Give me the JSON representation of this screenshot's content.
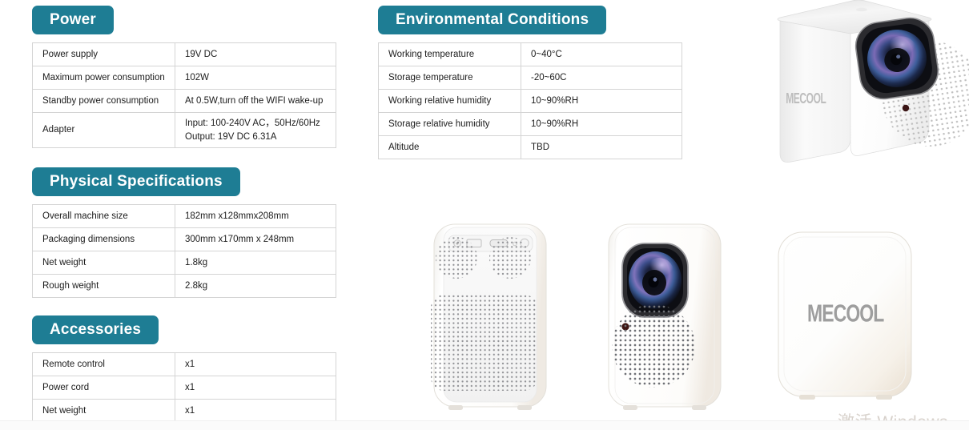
{
  "sections": [
    {
      "id": "power",
      "title": "Power",
      "rows": [
        {
          "key": "Power supply",
          "value": "19V DC"
        },
        {
          "key": "Maximum power consumption",
          "value": "102W"
        },
        {
          "key": "Standby power consumption",
          "value": "At 0.5W,turn off the WIFI wake-up"
        },
        {
          "key": "Adapter",
          "value_line1": "Input: 100-240V AC，50Hz/60Hz",
          "value_line2": "Output: 19V DC 6.31A"
        }
      ]
    },
    {
      "id": "physical",
      "title": "Physical Specifications",
      "rows": [
        {
          "key": "Overall machine size",
          "value": "182mm x128mmx208mm"
        },
        {
          "key": "Packaging dimensions",
          "value": "300mm x170mm x 248mm"
        },
        {
          "key": "Net weight",
          "value": "1.8kg"
        },
        {
          "key": "Rough weight",
          "value": "2.8kg"
        }
      ]
    },
    {
      "id": "accessories",
      "title": "Accessories",
      "rows": [
        {
          "key": "Remote control",
          "value": "x1"
        },
        {
          "key": "Power cord",
          "value": "x1"
        },
        {
          "key": "Net weight",
          "value": "x1"
        }
      ]
    },
    {
      "id": "environmental",
      "title": "Environmental Conditions",
      "rows": [
        {
          "key": "Working temperature",
          "value": "0~40°C"
        },
        {
          "key": "Storage temperature",
          "value": "-20~60C"
        },
        {
          "key": "Working relative humidity",
          "value": "10~90%RH"
        },
        {
          "key": "Storage relative humidity",
          "value": "10~90%RH"
        },
        {
          "key": "Altitude",
          "value": "TBD"
        }
      ]
    }
  ],
  "product": {
    "brand": "MECOOL",
    "views": [
      {
        "id": "hero-angled",
        "label": "MECOOL"
      },
      {
        "id": "rear-ports",
        "label": ""
      },
      {
        "id": "front-lens",
        "label": ""
      },
      {
        "id": "side-logo",
        "label": "MECOOL"
      }
    ]
  },
  "watermark": {
    "text": "激活 Windows"
  },
  "colors": {
    "accent": "#1e7d94",
    "table_border": "#d4d4d4",
    "text": "#1c1c1c",
    "body_white": "#f7f7f7",
    "logo_gray": "#b3b3b3",
    "watermark_gray": "#d8d2cc"
  }
}
